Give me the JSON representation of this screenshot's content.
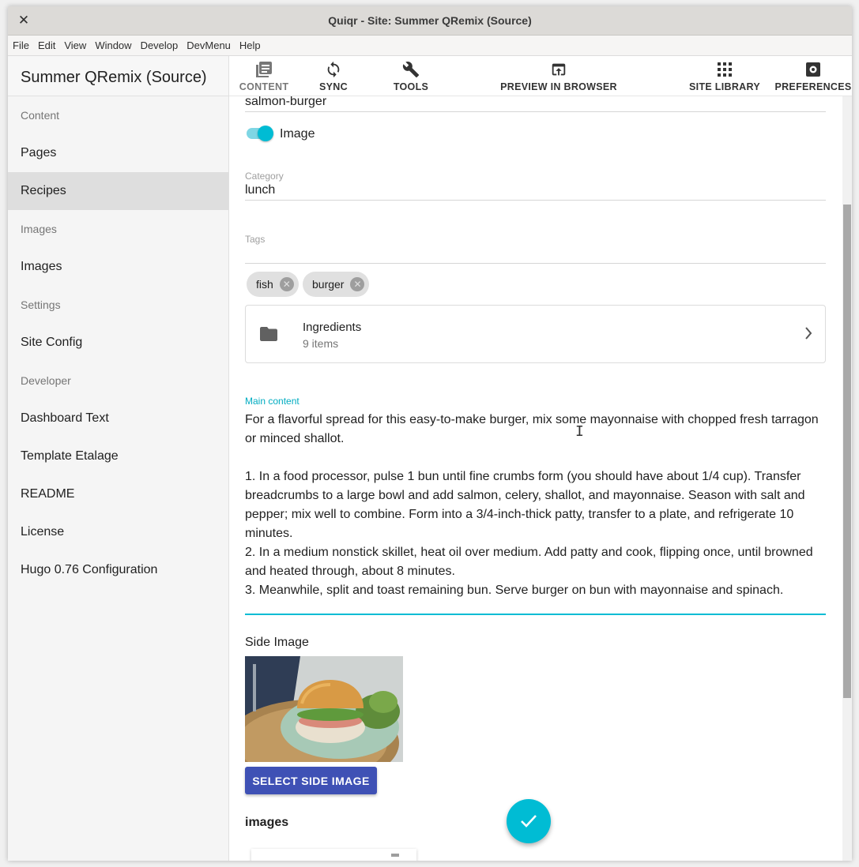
{
  "window": {
    "title": "Quiqr - Site: Summer QRemix (Source)",
    "close_glyph": "✕"
  },
  "menu": [
    "File",
    "Edit",
    "View",
    "Window",
    "Develop",
    "DevMenu",
    "Help"
  ],
  "sidebar": {
    "site_title": "Summer QRemix (Source)",
    "entries": [
      {
        "type": "section",
        "label": "Content"
      },
      {
        "type": "item",
        "label": "Pages"
      },
      {
        "type": "item",
        "label": "Recipes",
        "active": true
      },
      {
        "type": "section",
        "label": "Images"
      },
      {
        "type": "item",
        "label": "Images"
      },
      {
        "type": "section",
        "label": "Settings"
      },
      {
        "type": "item",
        "label": "Site Config"
      },
      {
        "type": "section",
        "label": "Developer"
      },
      {
        "type": "item",
        "label": "Dashboard Text"
      },
      {
        "type": "item",
        "label": "Template Etalage"
      },
      {
        "type": "item",
        "label": "README"
      },
      {
        "type": "item",
        "label": "License"
      },
      {
        "type": "item",
        "label": "Hugo 0.76 Configuration"
      }
    ]
  },
  "toolbar": {
    "content": "CONTENT",
    "sync": "SYNC",
    "tools": "TOOLS",
    "preview": "PREVIEW IN BROWSER",
    "library": "SITE LIBRARY",
    "preferences": "PREFERENCES"
  },
  "form": {
    "slug_value": "salmon-burger",
    "image_toggle_label": "Image",
    "image_toggle_on": true,
    "category_label": "Category",
    "category_value": "lunch",
    "tags_label": "Tags",
    "tags": [
      "fish",
      "burger"
    ],
    "ingredients": {
      "title": "Ingredients",
      "count": "9 items"
    },
    "main_content_label": "Main content",
    "main_content": "For a flavorful spread for this easy-to-make burger, mix some mayonnaise with chopped fresh tarragon or minced shallot.\n\n1. In a food processor, pulse 1 bun until fine crumbs form (you should have about 1/4 cup). Transfer breadcrumbs to a large bowl and add salmon, celery, shallot, and mayonnaise. Season with salt and pepper; mix well to combine. Form into a 3/4-inch-thick patty, transfer to a plate, and refrigerate 10 minutes.\n2. In a medium nonstick skillet, heat oil over medium. Add patty and cook, flipping once, until browned and heated through, about 8 minutes.\n3. Meanwhile, split and toast remaining bun. Serve burger on bun with mayonnaise and spinach.",
    "side_image_label": "Side Image",
    "select_side_image": "SELECT SIDE IMAGE",
    "images_label": "images"
  },
  "colors": {
    "accent": "#00bcd4",
    "primary_button": "#3f51b5",
    "sidebar_active": "#dedede"
  }
}
